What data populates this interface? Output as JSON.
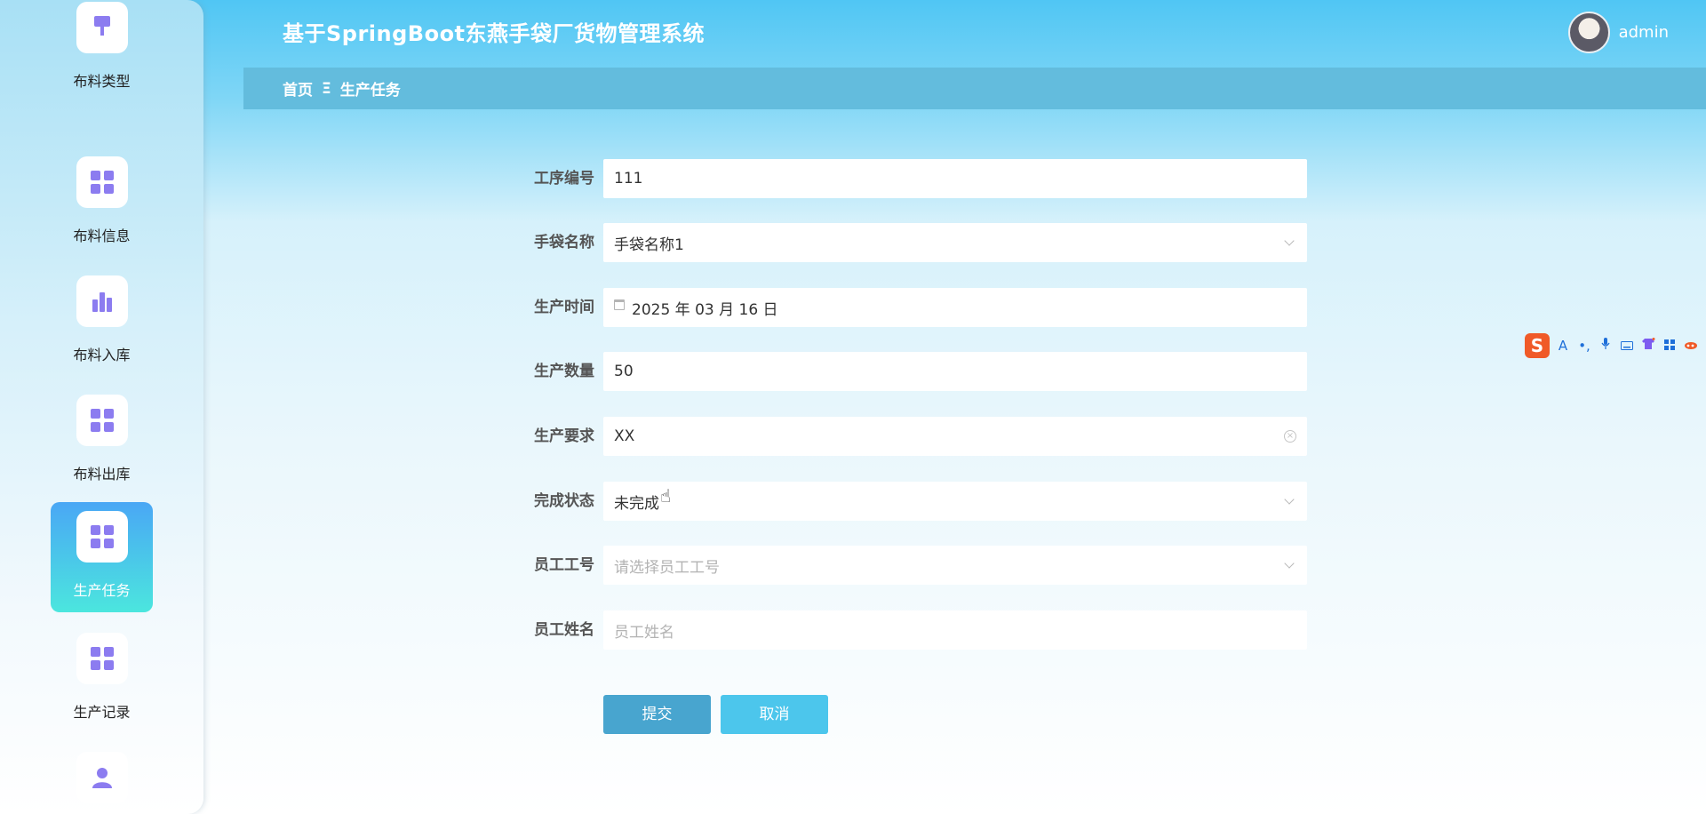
{
  "app": {
    "title": "基于SpringBoot东燕手袋厂货物管理系统"
  },
  "user": {
    "name": "admin"
  },
  "breadcrumb": {
    "home": "首页",
    "separator": "Ξ",
    "current": "生产任务"
  },
  "sidebar": {
    "items": [
      {
        "label": "布料类型",
        "icon": "brush-icon",
        "active": false
      },
      {
        "label": "布料信息",
        "icon": "grid-icon",
        "active": false
      },
      {
        "label": "布料入库",
        "icon": "bar-chart-icon",
        "active": false
      },
      {
        "label": "布料出库",
        "icon": "grid-icon",
        "active": false
      },
      {
        "label": "生产任务",
        "icon": "grid-icon",
        "active": true
      },
      {
        "label": "生产记录",
        "icon": "grid-icon",
        "active": false
      },
      {
        "label": "",
        "icon": "user-icon",
        "active": false
      }
    ]
  },
  "form": {
    "process_no": {
      "label": "工序编号",
      "value": "111"
    },
    "bag_name": {
      "label": "手袋名称",
      "value": "手袋名称1"
    },
    "prod_time": {
      "label": "生产时间",
      "value": "2025 年 03 月 16 日"
    },
    "prod_qty": {
      "label": "生产数量",
      "value": "50"
    },
    "prod_req": {
      "label": "生产要求",
      "value": "XX"
    },
    "status": {
      "label": "完成状态",
      "value": "未完成"
    },
    "emp_no": {
      "label": "员工工号",
      "placeholder": "请选择员工工号"
    },
    "emp_name": {
      "label": "员工姓名",
      "placeholder": "员工姓名"
    },
    "submit_label": "提交",
    "cancel_label": "取消"
  },
  "ime_toolbar": {
    "logo": "S",
    "items": [
      "A",
      "•,",
      "mic-icon",
      "keyboard-icon",
      "shirt-icon",
      "apps-icon",
      "skin-icon"
    ]
  },
  "colors": {
    "header_start": "#50c6f4",
    "breadcrumb_bar": "#63bcdd",
    "sidebar_active_top": "#4aa7f5",
    "sidebar_active_bottom": "#4be6de",
    "icon_purple": "#8c7cf0",
    "submit_button": "#48a5cf",
    "cancel_button": "#4cc6ec"
  }
}
